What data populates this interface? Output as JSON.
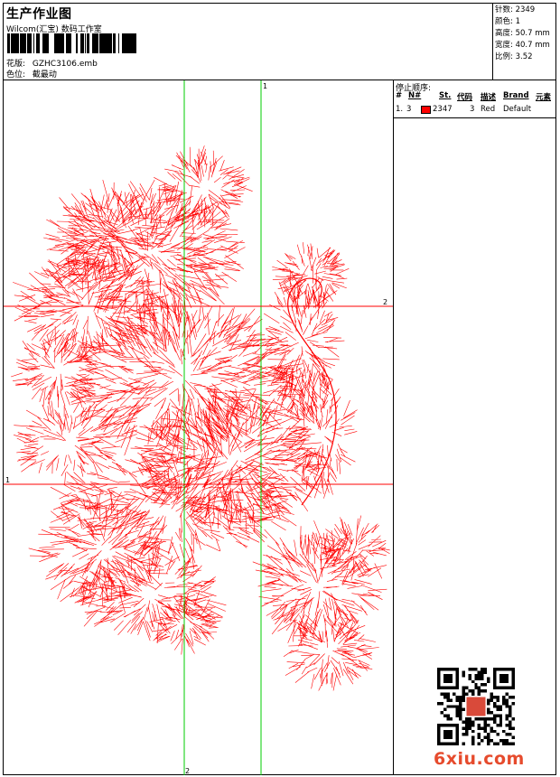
{
  "header": {
    "title": "生产作业图",
    "company": "Wilcom(汇宝) 数码工作室",
    "design_label": "花版:",
    "design_file": "GZHC3106.emb",
    "position_label": "色位:",
    "position_value": "截最动"
  },
  "stats": [
    {
      "label": "针数:",
      "value": "2349"
    },
    {
      "label": "颜色:",
      "value": "1"
    },
    {
      "label": "高度:",
      "value": "50.7 mm"
    },
    {
      "label": "宽度:",
      "value": "40.7 mm"
    },
    {
      "label": "比例:",
      "value": "3.52"
    }
  ],
  "guides": {
    "v1_label": "1",
    "v2_label": "2",
    "h1_label": "1",
    "h2_label": "2",
    "vertical_color": "#00cc00",
    "horizontal_color": "#ff0000"
  },
  "stitch_color": "#ff0000",
  "stop_sequence": {
    "title": "停止顺序:",
    "columns": [
      "#",
      "N#",
      "St.",
      "代码",
      "描述",
      "Brand",
      "元素"
    ],
    "rows": [
      {
        "index": "1.",
        "needle": "3",
        "swatch_color": "#ff0000",
        "stitches": "2347",
        "code": "3",
        "description": "Red",
        "brand": "Default",
        "element": ""
      }
    ]
  },
  "watermark": {
    "text": "6xiu.com",
    "color": "#e64b2d"
  }
}
